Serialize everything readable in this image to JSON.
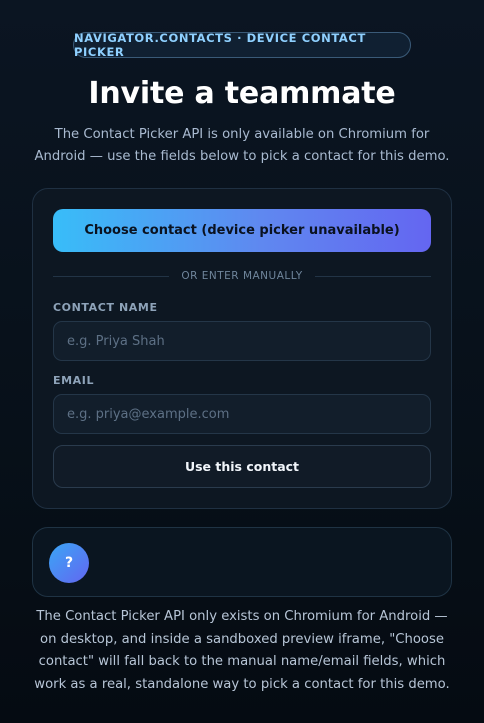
{
  "badge": "NAVIGATOR.CONTACTS · DEVICE CONTACT PICKER",
  "title": "Invite a teammate",
  "subtitle": "The Contact Picker API is only available on Chromium for Android — use the fields below to pick a contact for this demo.",
  "card": {
    "choose_button": "Choose contact (device picker unavailable)",
    "divider": "OR ENTER MANUALLY",
    "name_label": "CONTACT NAME",
    "name_placeholder": "e.g. Priya Shah",
    "name_value": "",
    "email_label": "EMAIL",
    "email_placeholder": "e.g. priya@example.com",
    "email_value": "",
    "use_button": "Use this contact"
  },
  "help": {
    "icon": "question-mark-icon",
    "icon_glyph": "?"
  },
  "footnote": "The Contact Picker API only exists on Chromium for Android — on desktop, and inside a sandboxed preview iframe, \"Choose contact\" will fall back to the manual name/email fields, which work as a real, standalone way to pick a contact for this demo.",
  "colors": {
    "accent_start": "#38bdf8",
    "accent_end": "#6366f1",
    "background": "#071019",
    "card": "#0d1722"
  }
}
